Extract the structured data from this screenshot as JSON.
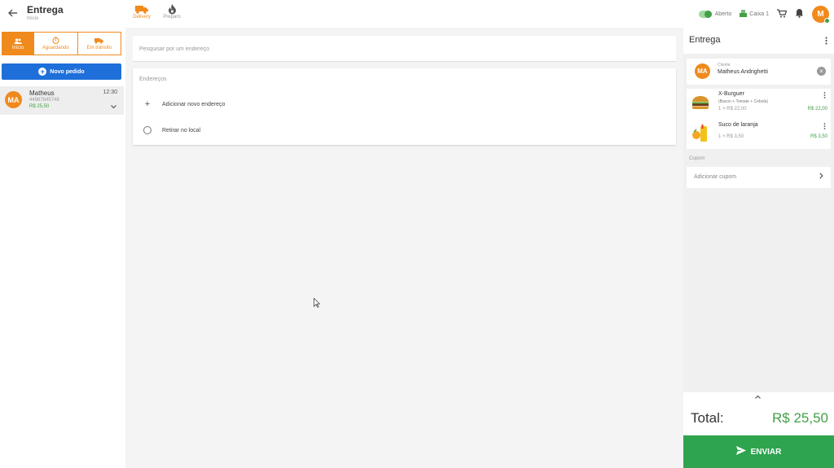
{
  "header": {
    "title": "Entrega",
    "subtitle": "Início",
    "modes": [
      {
        "label": "Delivery",
        "icon": "truck-icon",
        "active": true
      },
      {
        "label": "Preparo",
        "icon": "flame-icon",
        "active": false
      }
    ],
    "store_status": "Aberto",
    "cashier": "Caixa 1",
    "user_initial": "M"
  },
  "sidebar": {
    "status_tabs": [
      {
        "label": "Início",
        "icon": "people-icon"
      },
      {
        "label": "Aguardando",
        "icon": "timer-icon"
      },
      {
        "label": "Em trânsito",
        "icon": "truck-icon"
      }
    ],
    "new_order_label": "Novo pedido",
    "orders": [
      {
        "initials": "MA",
        "name": "Matheus",
        "phone": "44987845748",
        "price": "R$ 25,50",
        "time": "12:30"
      }
    ]
  },
  "main": {
    "search_placeholder": "Pesquisar por um endereço",
    "addresses_header": "Endereços",
    "add_address_label": "Adicionar novo endereço",
    "pickup_label": "Retirar no local"
  },
  "cart": {
    "title": "Entrega",
    "client_label": "Cliente",
    "client_name": "Matheus Andrighetti",
    "client_initials": "MA",
    "items": [
      {
        "name": "X-Burguer",
        "description": "(Bacon + Tomate + Cebola)",
        "qty_price": "1 × R$ 22,00",
        "subtotal": "R$ 22,00"
      },
      {
        "name": "Suco de laranja",
        "description": "",
        "qty_price": "1 × R$ 3,50",
        "subtotal": "R$ 3,50"
      }
    ],
    "coupon_label": "Cupom",
    "coupon_action": "Adicionar cupom",
    "total_label": "Total:",
    "total_value": "R$ 25,50",
    "send_label": "ENVIAR"
  },
  "colors": {
    "accent": "#f08a1c",
    "primary": "#1e6fd9",
    "success": "#43a047",
    "send": "#2ea44f"
  }
}
